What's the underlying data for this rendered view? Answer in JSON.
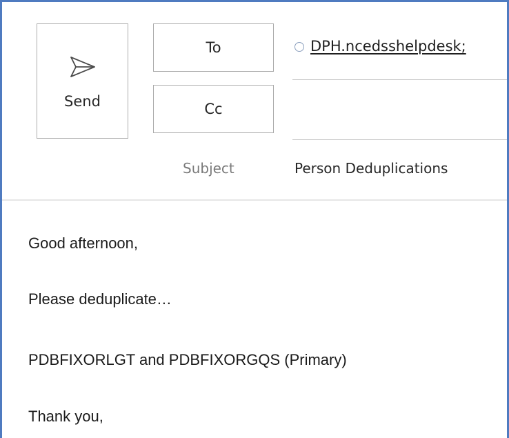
{
  "compose": {
    "send_label": "Send",
    "to_label": "To",
    "cc_label": "Cc",
    "to_recipients": [
      {
        "name": "DPH.ncedsshelpdesk;"
      }
    ],
    "cc_value": "",
    "subject_label": "Subject",
    "subject_value": "Person Deduplications"
  },
  "body": {
    "lines": [
      "Good afternoon,",
      "Please deduplicate…",
      "PDBFIXORLGT and PDBFIXORGQS (Primary)",
      "Thank you,"
    ]
  },
  "icons": {
    "send": "send-paper-plane-icon",
    "presence": "presence-status-icon"
  },
  "colors": {
    "frame_border": "#4f7bc0",
    "button_border": "#ababab",
    "subject_label": "#7a7a7a"
  }
}
